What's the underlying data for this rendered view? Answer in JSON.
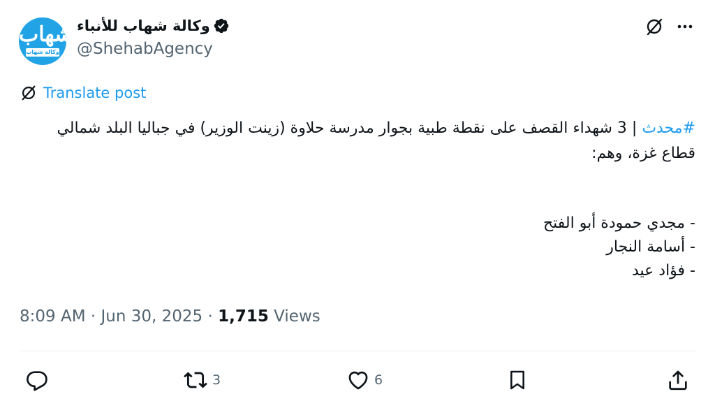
{
  "author": {
    "display_name": "وكالة شهاب للأنباء",
    "handle": "@ShehabAgency",
    "avatar_text": "شهاب",
    "avatar_subtext": "وكالة شهاب للأنباء",
    "verified": true
  },
  "translate": {
    "label": "Translate post",
    "icon": "translate-icon"
  },
  "post": {
    "hashtag": "#محدث",
    "line1_rest": " | 3 شهداء القصف على نقطة طبية بجوار مدرسة حلاوة (زينت الوزير) في جباليا البلد شمالي",
    "line2": "قطاع غزة، وهم:",
    "names": [
      "- مجدي حمودة أبو الفتح",
      "- أسامة النجار",
      "- فؤاد عيد"
    ]
  },
  "meta": {
    "time": "8:09 AM",
    "sep1": " · ",
    "date": "Jun 30, 2025",
    "sep2": " · ",
    "views_count": "1,715",
    "views_label": " Views"
  },
  "actions": {
    "reply": {
      "icon": "reply-icon",
      "count": ""
    },
    "repost": {
      "icon": "repost-icon",
      "count": "3"
    },
    "like": {
      "icon": "heart-icon",
      "count": "6"
    },
    "bookmark": {
      "icon": "bookmark-icon",
      "count": ""
    },
    "share": {
      "icon": "share-icon",
      "count": ""
    }
  },
  "colors": {
    "accent": "#1d9bf0",
    "text": "#0f1419",
    "muted": "#536471",
    "avatar_bg": "#21a3e6"
  }
}
